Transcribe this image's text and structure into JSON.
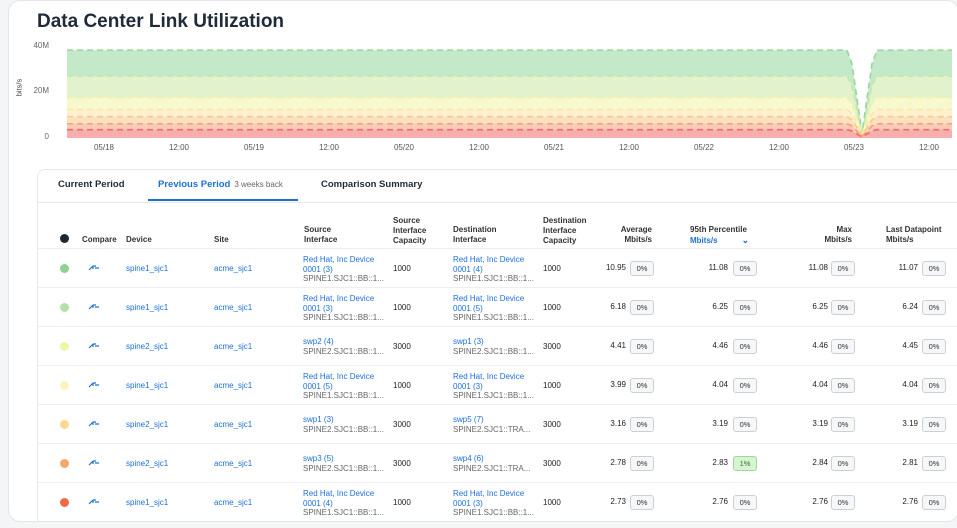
{
  "title": "Data Center Link Utilization",
  "chart_data": {
    "type": "area",
    "ylabel": "bits/s",
    "yticks": [
      "40M",
      "20M",
      "0"
    ],
    "ylim": [
      0,
      40000000
    ],
    "xticks": [
      "05/18",
      "12:00",
      "05/19",
      "12:00",
      "05/20",
      "12:00",
      "05/21",
      "12:00",
      "05/22",
      "12:00",
      "05/23",
      "12:00"
    ],
    "series": [
      {
        "color": "#93d79a",
        "level": 37000000,
        "dip": 2000000
      },
      {
        "color": "#c9e8a3",
        "level": 26000000,
        "dip": 1800000
      },
      {
        "color": "#f2f2a6",
        "level": 17000000,
        "dip": 1500000
      },
      {
        "color": "#fbe6a8",
        "level": 12000000,
        "dip": 1200000
      },
      {
        "color": "#f8c98a",
        "level": 9000000,
        "dip": 1000000
      },
      {
        "color": "#f3a07c",
        "level": 6000000,
        "dip": 700000
      },
      {
        "color": "#ee6b6b",
        "level": 3500000,
        "dip": 400000
      }
    ]
  },
  "tabs": {
    "current": "Current Period",
    "previous": "Previous Period",
    "previous_sub": "3 weeks back",
    "comparison": "Comparison Summary"
  },
  "headers": {
    "compare": "Compare",
    "device": "Device",
    "site": "Site",
    "src_if_1": "Source",
    "src_if_2": "Interface",
    "src_cap_1": "Source",
    "src_cap_2": "Interface",
    "src_cap_3": "Capacity",
    "dst_if_1": "Destination",
    "dst_if_2": "Interface",
    "dst_cap_1": "Destination",
    "dst_cap_2": "Interface",
    "dst_cap_3": "Capacity",
    "avg_1": "Average",
    "avg_2": "Mbits/s",
    "p95_1": "95th Percentile",
    "p95_2": "Mbits/s",
    "max_1": "Max",
    "max_2": "Mbits/s",
    "last_1": "Last Datapoint",
    "last_2": "Mbits/s"
  },
  "rows": [
    {
      "color": "#8fd18f",
      "device": "spine1_sjc1",
      "site": "acme_sjc1",
      "src1": "Red Hat, Inc Device",
      "src2": "0001 (3)",
      "src3": "SPINE1.SJC1::BB::1...",
      "src_cap": "1000",
      "dst1": "Red Hat, Inc Device",
      "dst2": "0001 (4)",
      "dst3": "SPINE1.SJC1::BB::1...",
      "dst_cap": "1000",
      "avg": "10.95",
      "avg_pct": "0%",
      "p95": "11.08",
      "p95_pct": "0%",
      "max": "11.08",
      "max_pct": "0%",
      "last": "11.07",
      "last_pct": "0%"
    },
    {
      "color": "#b2e2a8",
      "device": "spine1_sjc1",
      "site": "acme_sjc1",
      "src1": "Red Hat, Inc Device",
      "src2": "0001 (3)",
      "src3": "SPINE1.SJC1::BB::1...",
      "src_cap": "1000",
      "dst1": "Red Hat, Inc Device",
      "dst2": "0001 (5)",
      "dst3": "SPINE1.SJC1::BB::1...",
      "dst_cap": "1000",
      "avg": "6.18",
      "avg_pct": "0%",
      "p95": "6.25",
      "p95_pct": "0%",
      "max": "6.25",
      "max_pct": "0%",
      "last": "6.24",
      "last_pct": "0%"
    },
    {
      "color": "#eef5a8",
      "device": "spine2_sjc1",
      "site": "acme_sjc1",
      "src1": "swp2 (4)",
      "src2": "SPINE2.SJC1::BB::1...",
      "src3": "",
      "src_cap": "3000",
      "dst1": "swp1 (3)",
      "dst2": "SPINE2.SJC1::BB::1...",
      "dst3": "",
      "dst_cap": "3000",
      "avg": "4.41",
      "avg_pct": "0%",
      "p95": "4.46",
      "p95_pct": "0%",
      "max": "4.46",
      "max_pct": "0%",
      "last": "4.45",
      "last_pct": "0%"
    },
    {
      "color": "#fdf3bf",
      "device": "spine1_sjc1",
      "site": "acme_sjc1",
      "src1": "Red Hat, Inc Device",
      "src2": "0001 (5)",
      "src3": "SPINE1.SJC1::BB::1...",
      "src_cap": "1000",
      "dst1": "Red Hat, Inc Device",
      "dst2": "0001 (3)",
      "dst3": "SPINE1.SJC1::BB::1...",
      "dst_cap": "1000",
      "avg": "3.99",
      "avg_pct": "0%",
      "p95": "4.04",
      "p95_pct": "0%",
      "max": "4.04",
      "max_pct": "0%",
      "last": "4.04",
      "last_pct": "0%"
    },
    {
      "color": "#fbd98f",
      "device": "spine2_sjc1",
      "site": "acme_sjc1",
      "src1": "swp1 (3)",
      "src2": "SPINE2.SJC1::BB::1...",
      "src3": "",
      "src_cap": "3000",
      "dst1": "swp5 (7)",
      "dst2": "SPINE2.SJC1::TRA...",
      "dst3": "",
      "dst_cap": "3000",
      "avg": "3.16",
      "avg_pct": "0%",
      "p95": "3.19",
      "p95_pct": "0%",
      "max": "3.19",
      "max_pct": "0%",
      "last": "3.19",
      "last_pct": "0%"
    },
    {
      "color": "#f5a86b",
      "device": "spine2_sjc1",
      "site": "acme_sjc1",
      "src1": "swp3 (5)",
      "src2": "SPINE2.SJC1::BB::1...",
      "src3": "",
      "src_cap": "3000",
      "dst1": "swp4 (6)",
      "dst2": "SPINE2.SJC1::TRA...",
      "dst3": "",
      "dst_cap": "3000",
      "avg": "2.78",
      "avg_pct": "0%",
      "p95": "2.83",
      "p95_pct": "1%",
      "max": "2.84",
      "max_pct": "0%",
      "last": "2.81",
      "last_pct": "0%"
    },
    {
      "color": "#ec6a4a",
      "device": "spine1_sjc1",
      "site": "acme_sjc1",
      "src1": "Red Hat, Inc Device",
      "src2": "0001 (4)",
      "src3": "SPINE1.SJC1::BB::1...",
      "src_cap": "1000",
      "dst1": "Red Hat, Inc Device",
      "dst2": "0001 (3)",
      "dst3": "SPINE1.SJC1::BB::1...",
      "dst_cap": "1000",
      "avg": "2.73",
      "avg_pct": "0%",
      "p95": "2.76",
      "p95_pct": "0%",
      "max": "2.76",
      "max_pct": "0%",
      "last": "2.76",
      "last_pct": "0%"
    }
  ]
}
